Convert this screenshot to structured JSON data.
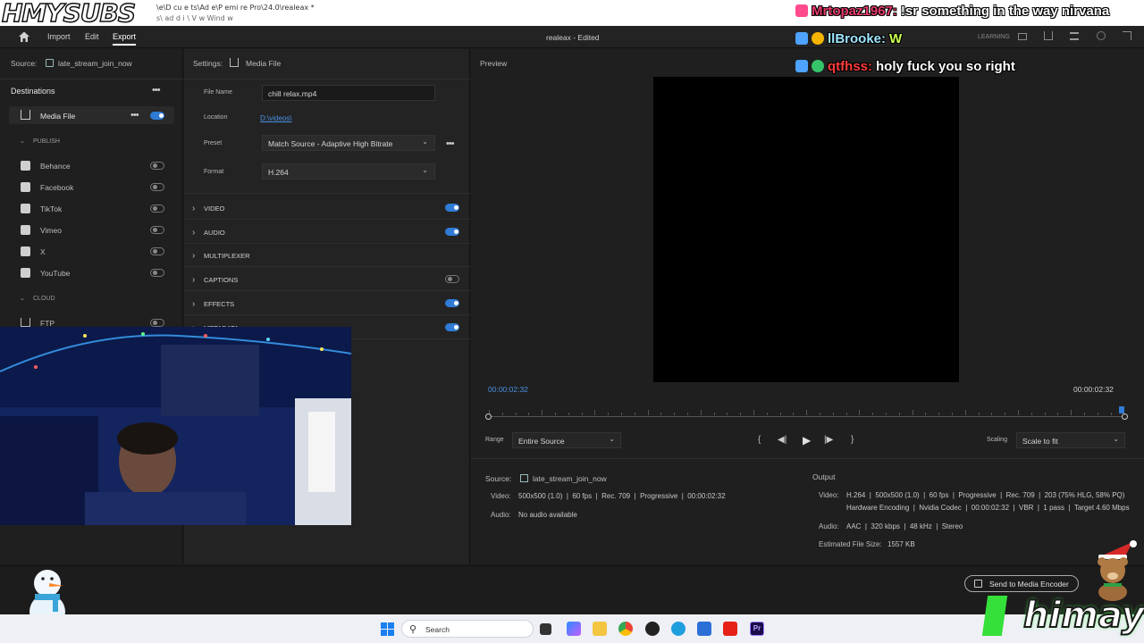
{
  "window": {
    "overlay_logo": "HMYSUBS",
    "path_line1": "\\e\\D cu e ts\\Ad e\\P emi re Pro\\24.0\\realeax *",
    "path_line2": "s\\ ad d i \\ V w Wind w",
    "project_title": "realeax - Edited",
    "learning_label": "LEARNING"
  },
  "menu": {
    "import": "Import",
    "edit": "Edit",
    "export": "Export"
  },
  "source": {
    "label": "Source:",
    "sequence": "late_stream_join_now"
  },
  "destinations": {
    "title": "Destinations",
    "media_file": "Media File",
    "publish_label": "PUBLISH",
    "publish_items": [
      {
        "label": "Behance",
        "icon": "behance-icon"
      },
      {
        "label": "Facebook",
        "icon": "facebook-icon"
      },
      {
        "label": "TikTok",
        "icon": "tiktok-icon"
      },
      {
        "label": "Vimeo",
        "icon": "vimeo-icon"
      },
      {
        "label": "X",
        "icon": "x-icon"
      },
      {
        "label": "YouTube",
        "icon": "youtube-icon"
      }
    ],
    "cloud_label": "CLOUD",
    "ftp": "FTP"
  },
  "settings": {
    "label": "Settings:",
    "target": "Media File",
    "file_name_label": "File Name",
    "file_name": "chill relax.mp4",
    "location_label": "Location",
    "location": "D:\\videos\\",
    "preset_label": "Preset",
    "preset": "Match Source - Adaptive High Bitrate",
    "format_label": "Format",
    "format": "H.264",
    "sections": [
      "VIDEO",
      "AUDIO",
      "MULTIPLEXER",
      "CAPTIONS",
      "EFFECTS",
      "METADATA"
    ]
  },
  "preview": {
    "title": "Preview",
    "timecode_in": "00:00:02:32",
    "timecode_out": "00:00:02:32",
    "range_label": "Range",
    "range_value": "Entire Source",
    "scaling_label": "Scaling",
    "scaling_value": "Scale to fit"
  },
  "source_info": {
    "label": "Source:",
    "sequence": "late_stream_join_now",
    "video_label": "Video:",
    "video": "500x500 (1.0)  |  60 fps  |  Rec. 709  |  Progressive  |  00:00:02:32",
    "audio_label": "Audio:",
    "audio": "No audio available"
  },
  "output_info": {
    "title": "Output",
    "video_label": "Video:",
    "video_line1": "H.264  |  500x500 (1.0)  |  60 fps  |  Progressive  |  Rec. 709  |  203 (75% HLG, 58% PQ)",
    "video_line2": "Hardware Encoding  |  Nvidia Codec  |  00:00:02:32  |  VBR  |  1 pass  |  Target 4.60 Mbps",
    "audio_label": "Audio:",
    "audio": "AAC  |  320 kbps  |  48 kHz  |  Stereo",
    "size_label": "Estimated File Size:",
    "size": "1557 KB"
  },
  "footer": {
    "send_button": "Send to Media Encoder"
  },
  "chat": [
    {
      "user": "Mrtopaz1967:",
      "user_color": "#e83b6b",
      "message": "!sr something in the way nirvana"
    },
    {
      "user": "llBrooke:",
      "user_color": "#9ee6ff",
      "message": "W"
    },
    {
      "user": "qtfhss:",
      "user_color": "#ff3b3b",
      "message": "holy fuck you so right"
    }
  ],
  "taskbar": {
    "search_placeholder": "Search"
  },
  "stream_overlay": {
    "name": "himay"
  },
  "colors": {
    "accent": "#2f7bd6",
    "panel": "#1f1f1f",
    "toggle_on": "#2f7bd6"
  }
}
